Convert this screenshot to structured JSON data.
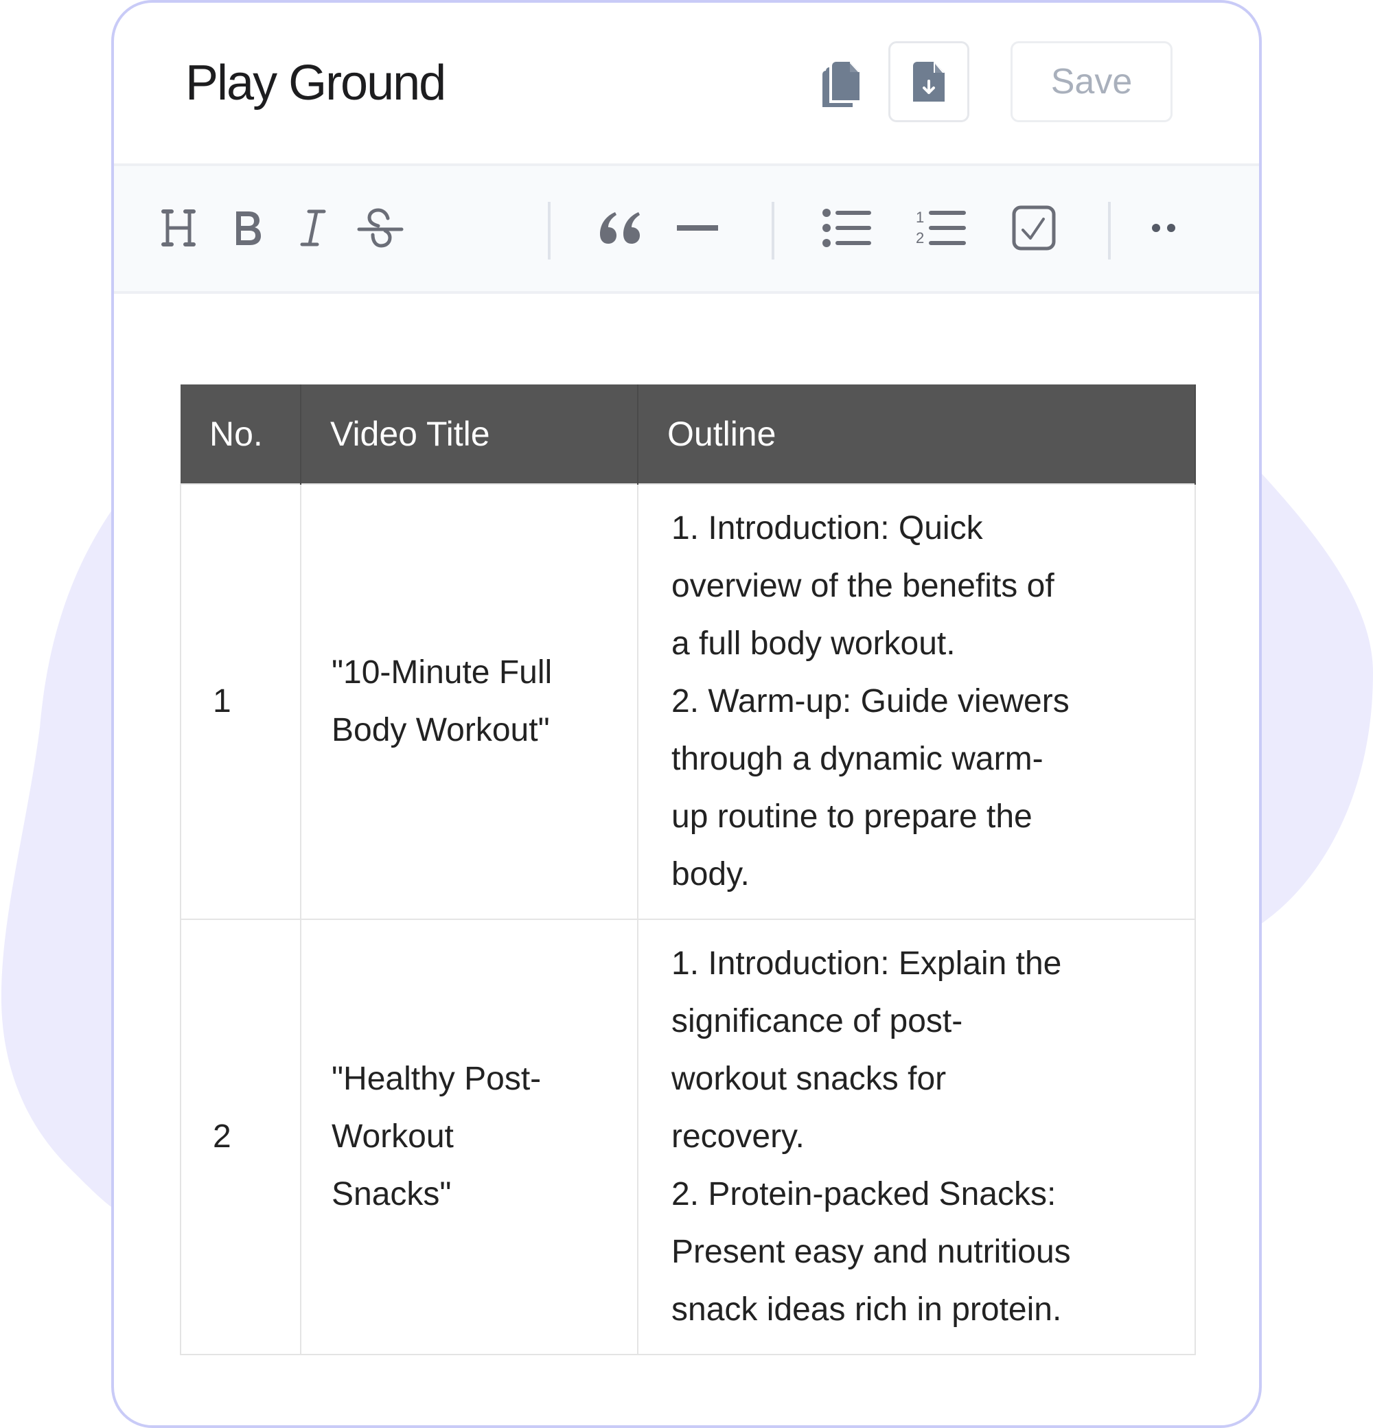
{
  "header": {
    "title": "Play Ground",
    "copy_icon": "copy-icon",
    "export_icon": "file-download-icon",
    "save_label": "Save"
  },
  "toolbar": {
    "items": [
      {
        "name": "heading",
        "icon": "heading-icon"
      },
      {
        "name": "bold",
        "icon": "bold-icon"
      },
      {
        "name": "italic",
        "icon": "italic-icon"
      },
      {
        "name": "strikethrough",
        "icon": "strikethrough-icon"
      },
      {
        "name": "blockquote",
        "icon": "quote-icon"
      },
      {
        "name": "horizontal-rule",
        "icon": "horizontal-rule-icon"
      },
      {
        "name": "bullet-list",
        "icon": "bullet-list-icon"
      },
      {
        "name": "ordered-list",
        "icon": "ordered-list-icon"
      },
      {
        "name": "task-list",
        "icon": "checkbox-icon"
      },
      {
        "name": "more",
        "icon": "more-icon"
      }
    ]
  },
  "table": {
    "headers": [
      "No.",
      "Video Title",
      "Outline"
    ],
    "rows": [
      {
        "no": "1",
        "title_lines": [
          "\"10-Minute Full",
          "Body Workout\""
        ],
        "outline_lines": [
          "1. Introduction: Quick",
          "overview of the benefits of",
          "a full body workout.",
          "2. Warm-up: Guide viewers",
          "through a dynamic warm-",
          "up routine to prepare the",
          "body."
        ]
      },
      {
        "no": "2",
        "title_lines": [
          "\"Healthy Post-",
          "Workout",
          "Snacks\""
        ],
        "outline_lines": [
          "1. Introduction: Explain the",
          "significance of post-",
          "workout snacks for",
          "recovery.",
          "2. Protein-packed Snacks:",
          "Present easy and nutritious",
          "snack ideas rich in protein."
        ]
      }
    ]
  },
  "colors": {
    "card_border": "#c9cbf7",
    "background_blob": "#ecebfd",
    "table_header_bg": "#555555",
    "icon_color": "#6b6e78",
    "file_icon_color": "#6f7d90"
  }
}
